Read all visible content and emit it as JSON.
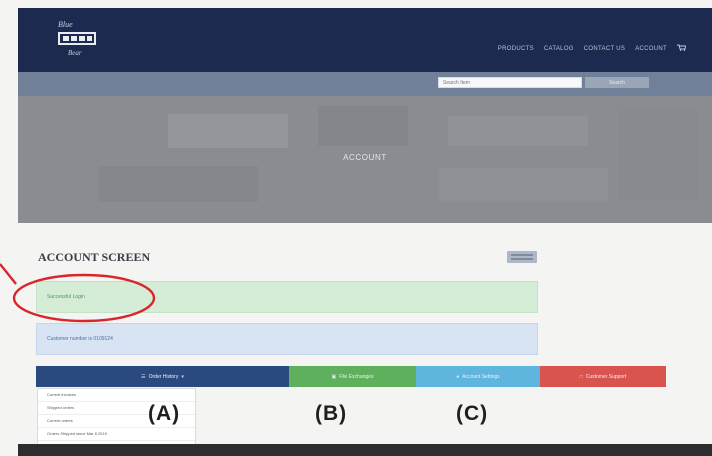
{
  "colors": {
    "nav_bg": "#1b2a4e",
    "hero_bg": "#8a8c92",
    "success": "#d5ecd7",
    "info": "#d8e3f3",
    "tab_order_history": "#2a4a7f",
    "tab_green": "#5fb05d",
    "tab_light_blue": "#5eb6de",
    "tab_red": "#d9534f",
    "annotation": "#d9262b"
  },
  "nav": {
    "logo_icon": "brand-logo-icon",
    "links": [
      "PRODUCTS",
      "CATALOG",
      "CONTACT US",
      "ACCOUNT"
    ],
    "cart_icon": "cart-icon"
  },
  "search": {
    "placeholder": "Search Item",
    "button_label": "Search"
  },
  "hero": {
    "title": "ACCOUNT"
  },
  "account": {
    "section_title": "ACCOUNT SCREEN",
    "success_text": "Successful Login",
    "info_text": "Customer number is 0109124"
  },
  "tabs": {
    "order_history": "Order History",
    "tab_b": "File Exchanges",
    "tab_c": "Account Settings",
    "tab_d": "Customer Support"
  },
  "dropdown": {
    "items": [
      "Current invoices",
      "Shipped orders",
      "Current orders",
      "Orders Shipped since Mar 8 2019"
    ]
  },
  "annotations": {
    "label_a": "(A)",
    "label_b": "(B)",
    "label_c": "(C)"
  }
}
